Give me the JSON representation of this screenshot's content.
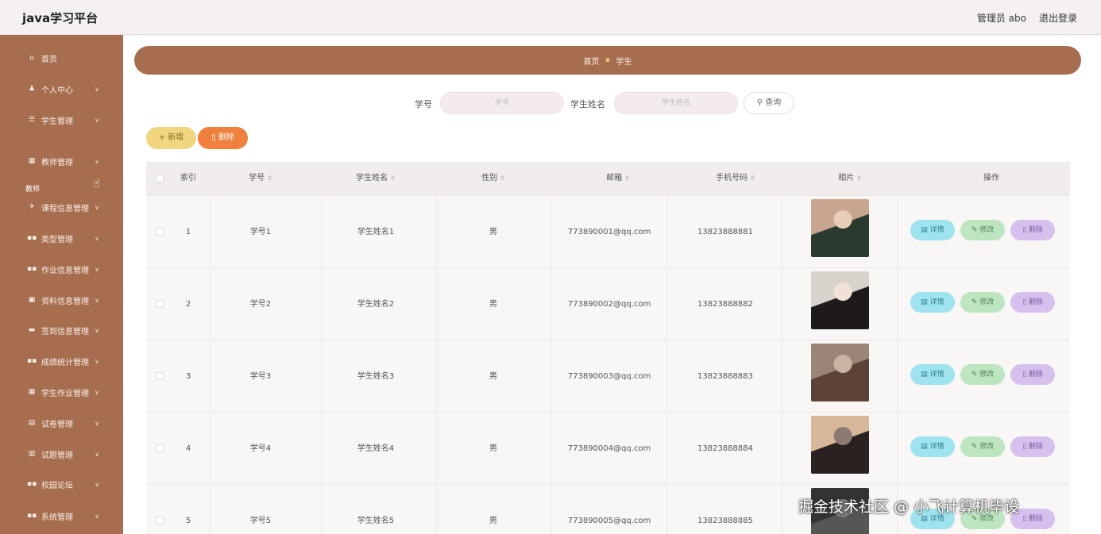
{
  "app": {
    "title": "java学习平台",
    "user_label": "管理员 abo",
    "logout_label": "退出登录"
  },
  "sidebar": {
    "section_label": "教师",
    "items": [
      {
        "icon": "home-icon",
        "glyph": "⌂",
        "label": "首页",
        "has_arrow": false
      },
      {
        "icon": "user-icon",
        "glyph": "♟",
        "label": "个人中心",
        "has_arrow": true
      },
      {
        "icon": "list-icon",
        "glyph": "☰",
        "label": "学生管理",
        "has_arrow": true
      },
      {
        "icon": "card-icon",
        "glyph": "▦",
        "label": "教师管理",
        "has_arrow": true
      },
      {
        "icon": "send-icon",
        "glyph": "✈",
        "label": "课程信息管理",
        "has_arrow": true
      },
      {
        "icon": "grid-icon",
        "glyph": "▪▪",
        "label": "类型管理",
        "has_arrow": true
      },
      {
        "icon": "grid-icon",
        "glyph": "▪▪",
        "label": "作业信息管理",
        "has_arrow": true
      },
      {
        "icon": "lock-icon",
        "glyph": "▣",
        "label": "资料信息管理",
        "has_arrow": true
      },
      {
        "icon": "image-icon",
        "glyph": "▬",
        "label": "签到信息管理",
        "has_arrow": true
      },
      {
        "icon": "grid-icon",
        "glyph": "▪▪",
        "label": "成绩统计管理",
        "has_arrow": true
      },
      {
        "icon": "table-icon",
        "glyph": "▦",
        "label": "学生作业管理",
        "has_arrow": true
      },
      {
        "icon": "doc-icon",
        "glyph": "▤",
        "label": "试卷管理",
        "has_arrow": true
      },
      {
        "icon": "chart-icon",
        "glyph": "▥",
        "label": "试题管理",
        "has_arrow": true
      },
      {
        "icon": "grid-icon",
        "glyph": "▪▪",
        "label": "校园论坛",
        "has_arrow": true
      },
      {
        "icon": "grid-icon",
        "glyph": "▪▪",
        "label": "系统管理",
        "has_arrow": true
      }
    ]
  },
  "breadcrumb": {
    "home": "首页",
    "current": "学生"
  },
  "search": {
    "id_label": "学号",
    "id_placeholder": "学号",
    "name_label": "学生姓名",
    "name_placeholder": "学生姓名",
    "query_label": "查询"
  },
  "actions": {
    "add_label": "新增",
    "delete_label": "删除"
  },
  "table": {
    "headers": [
      "索引",
      "学号",
      "学生姓名",
      "性别",
      "邮箱",
      "手机号码",
      "相片",
      "操作"
    ],
    "op_detail": "详情",
    "op_edit": "修改",
    "op_delete": "删除",
    "rows": [
      {
        "index": "1",
        "id": "学号1",
        "name": "学生姓名1",
        "gender": "男",
        "email": "773890001@qq.com",
        "phone": "13823888881",
        "photo_colors": [
          "#c8a58f",
          "#2b3a2e",
          "#e8cdb8"
        ]
      },
      {
        "index": "2",
        "id": "学号2",
        "name": "学生姓名2",
        "gender": "男",
        "email": "773890002@qq.com",
        "phone": "13823888882",
        "photo_colors": [
          "#d8d2cc",
          "#1e1a1a",
          "#efe1d6"
        ]
      },
      {
        "index": "3",
        "id": "学号3",
        "name": "学生姓名3",
        "gender": "男",
        "email": "773890003@qq.com",
        "phone": "13823888883",
        "photo_colors": [
          "#9a8576",
          "#5b4338",
          "#c9b3a2"
        ]
      },
      {
        "index": "4",
        "id": "学号4",
        "name": "学生姓名4",
        "gender": "男",
        "email": "773890004@qq.com",
        "phone": "13823888884",
        "photo_colors": [
          "#d7b79a",
          "#2a2220",
          "#8a7a70"
        ]
      },
      {
        "index": "5",
        "id": "学号5",
        "name": "学生姓名5",
        "gender": "男",
        "email": "773890005@qq.com",
        "phone": "13823888885",
        "photo_colors": [
          "#333333",
          "#555555",
          "#777777"
        ]
      }
    ]
  },
  "watermark": "掘金技术社区 @ 小飞计算机毕设"
}
